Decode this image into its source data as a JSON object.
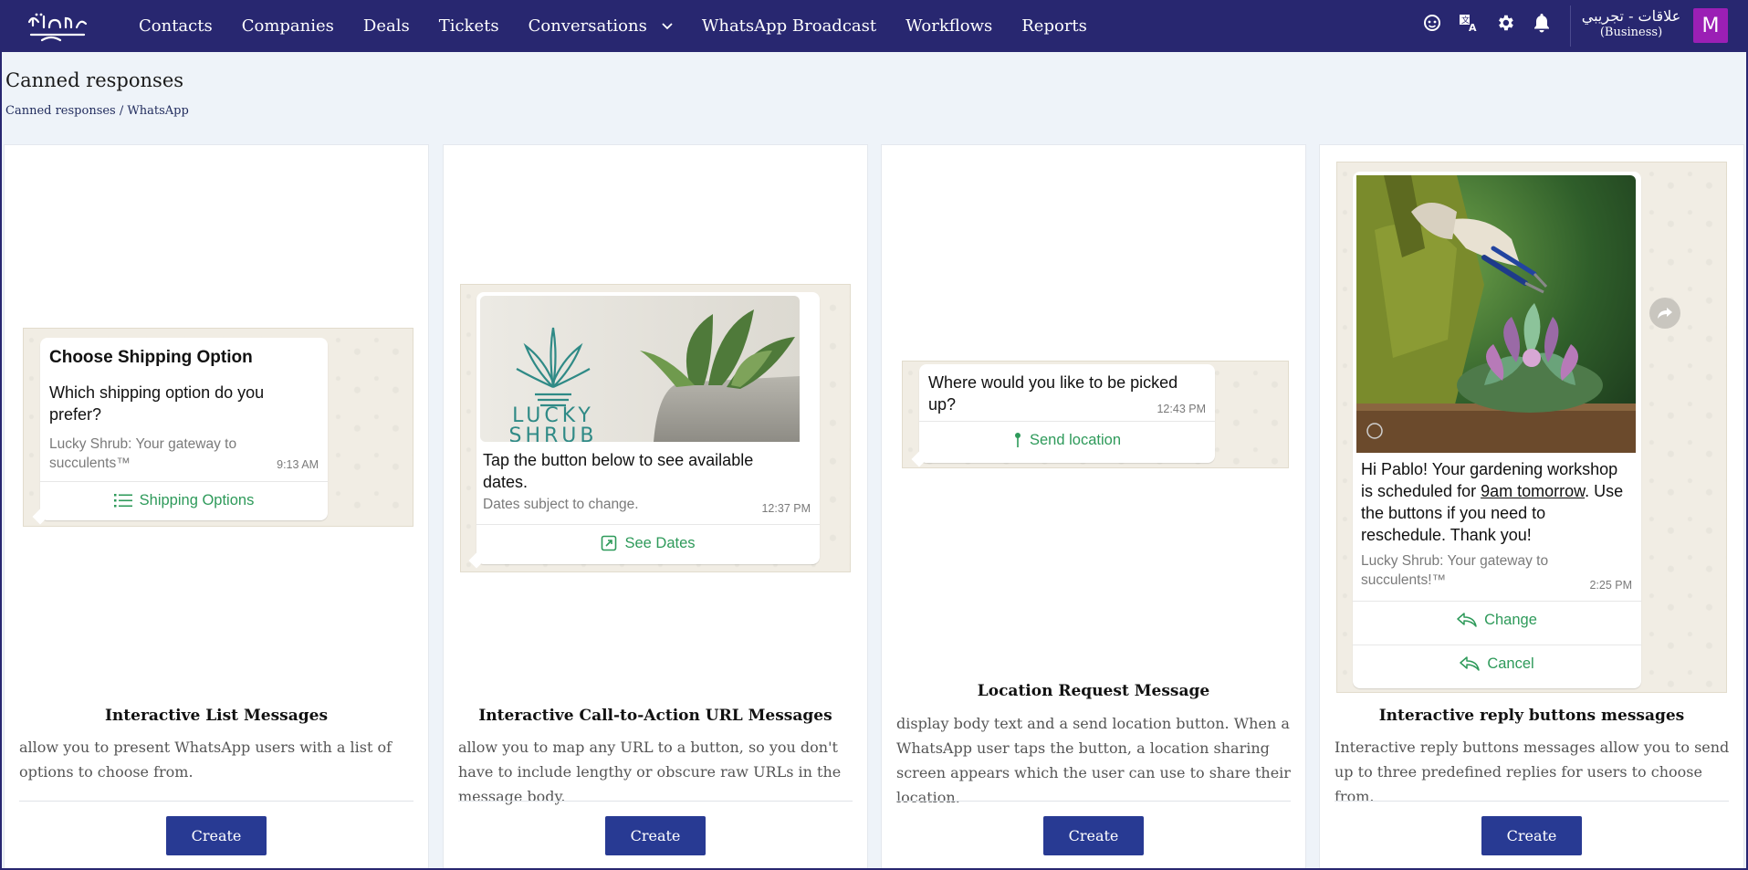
{
  "navbar": {
    "links": [
      "Contacts",
      "Companies",
      "Deals",
      "Tickets",
      "Conversations",
      "WhatsApp Broadcast",
      "Workflows",
      "Reports"
    ],
    "org_name": "علاقات - تجريبي",
    "org_plan": "(Business)",
    "avatar_letter": "M",
    "icons": [
      "chat-bot-icon",
      "translate-icon",
      "gear-icon",
      "bell-icon"
    ]
  },
  "page": {
    "title": "Canned responses",
    "breadcrumb": [
      "Canned responses",
      "WhatsApp"
    ],
    "breadcrumb_sep": " / "
  },
  "cards": [
    {
      "title": "Interactive List Messages",
      "description": "allow you to present WhatsApp users with a list of options to choose from.",
      "button": "Create",
      "preview": {
        "header": "Choose Shipping Option",
        "body": "Which shipping option do you prefer?",
        "footer": "Lucky Shrub: Your gateway to succulents™",
        "time": "9:13 AM",
        "action": "Shipping Options"
      }
    },
    {
      "title": "Interactive Call-to-Action URL Messages",
      "description": "allow you to map any URL to a button, so you don't have to include lengthy or obscure raw URLs in the message body.",
      "button": "Create",
      "preview": {
        "brand_line1": "LUCKY",
        "brand_line2": "SHRUB",
        "body": "Tap the button below to see available dates.",
        "footer": "Dates subject to change.",
        "time": "12:37 PM",
        "action": "See Dates"
      }
    },
    {
      "title": "Location Request Message",
      "description": "display body text and a send location button. When a WhatsApp user taps the button, a location sharing screen appears which the user can use to share their location.",
      "button": "Create",
      "preview": {
        "body": "Where would you like to be picked up?",
        "time": "12:43 PM",
        "action": "Send location"
      }
    },
    {
      "title": "Interactive reply buttons messages",
      "description": "Interactive reply buttons messages allow you to send up to three predefined replies for users to choose from.",
      "button": "Create",
      "preview": {
        "body_before": "Hi Pablo! Your gardening workshop is scheduled for ",
        "body_link": "9am tomorrow",
        "body_after": ". Use the buttons if you need to reschedule. Thank you!",
        "footer": "Lucky Shrub: Your gateway to succulents!™",
        "time": "2:25 PM",
        "action1": "Change",
        "action2": "Cancel"
      }
    }
  ]
}
